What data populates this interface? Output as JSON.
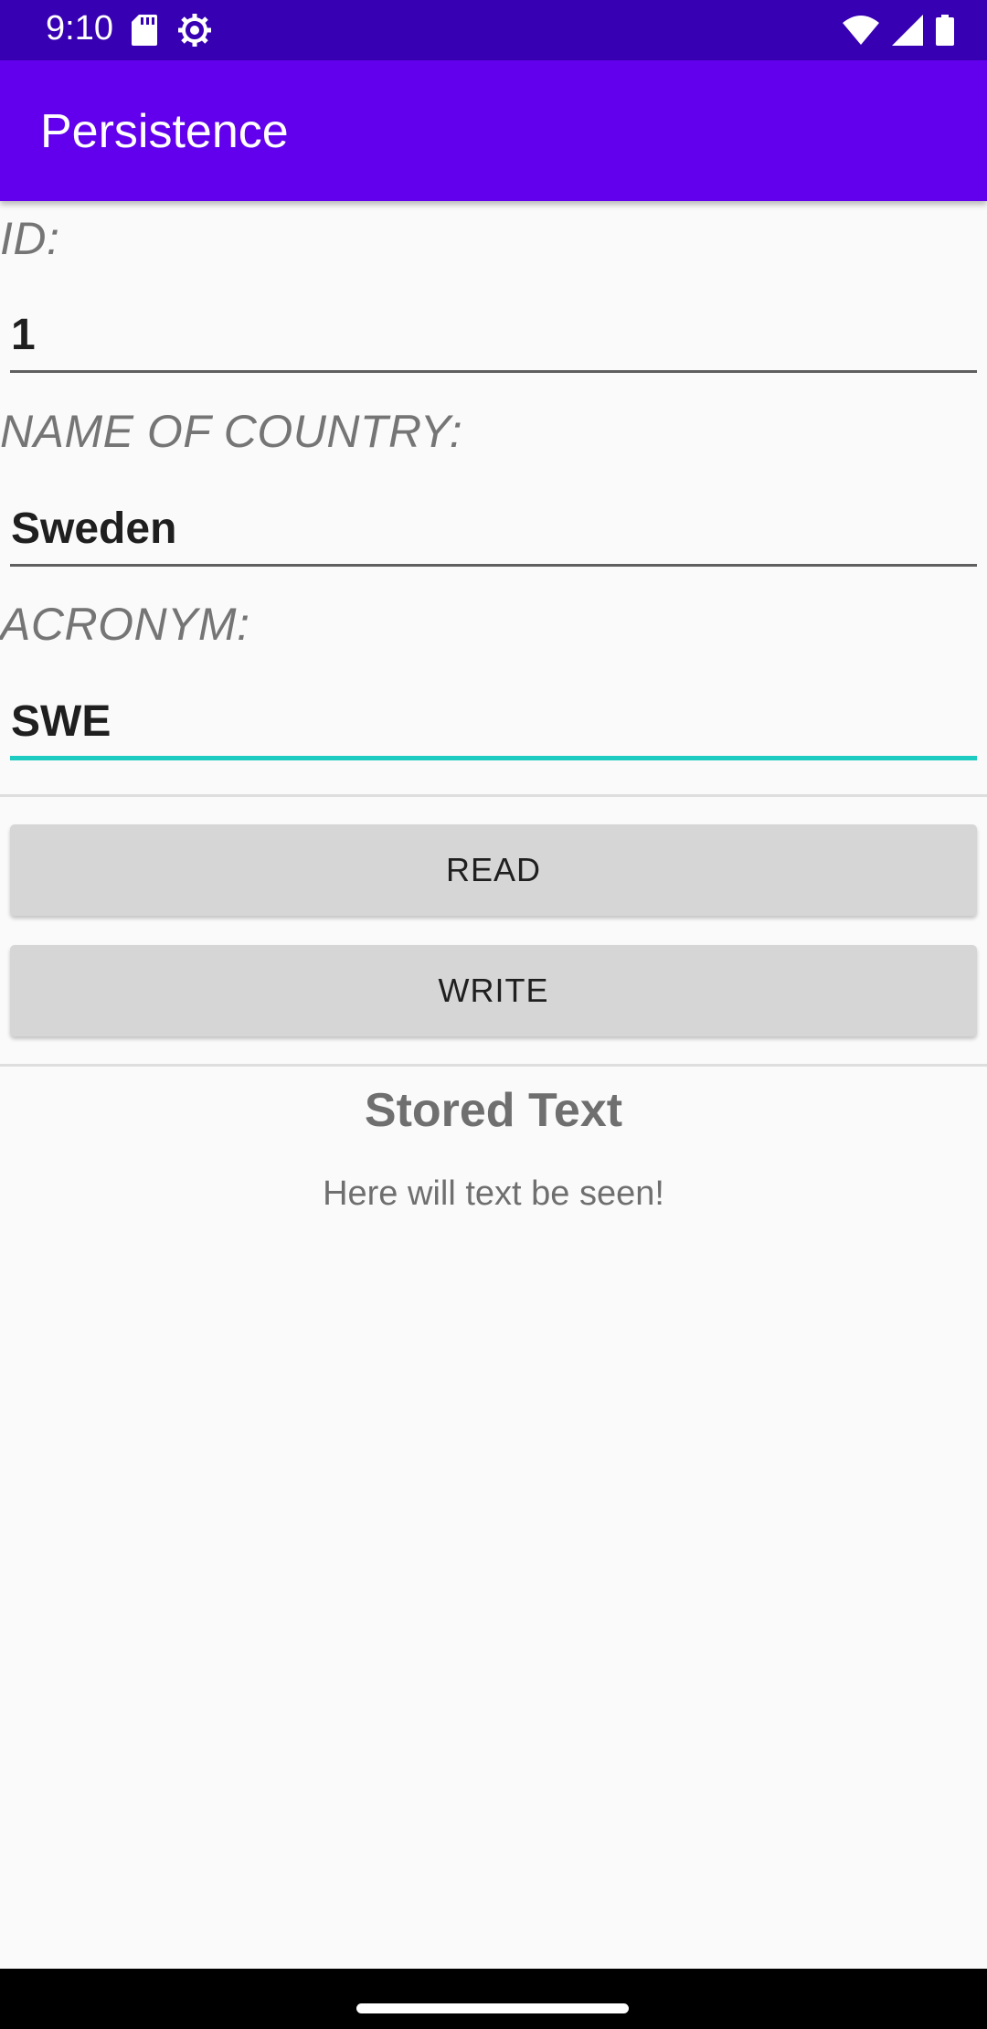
{
  "status_bar": {
    "time": "9:10",
    "left_icons": [
      "sd-card-icon",
      "settings-icon"
    ],
    "right_icons": [
      "wifi-icon",
      "signal-icon",
      "battery-icon"
    ]
  },
  "app_bar": {
    "title": "Persistence"
  },
  "form": {
    "id": {
      "label": "ID:",
      "value": "1"
    },
    "country": {
      "label": "NAME OF COUNTRY:",
      "value": "Sweden"
    },
    "acronym": {
      "label": "ACRONYM:",
      "value": "SWE"
    }
  },
  "buttons": {
    "read_label": "READ",
    "write_label": "WRITE"
  },
  "stored": {
    "title": "Stored Text",
    "body": "Here will text be seen!"
  },
  "colors": {
    "status_bar": "#3700b3",
    "app_bar": "#6200ee",
    "focus_accent": "#1ecbc0",
    "button_bg": "#d6d6d6"
  }
}
